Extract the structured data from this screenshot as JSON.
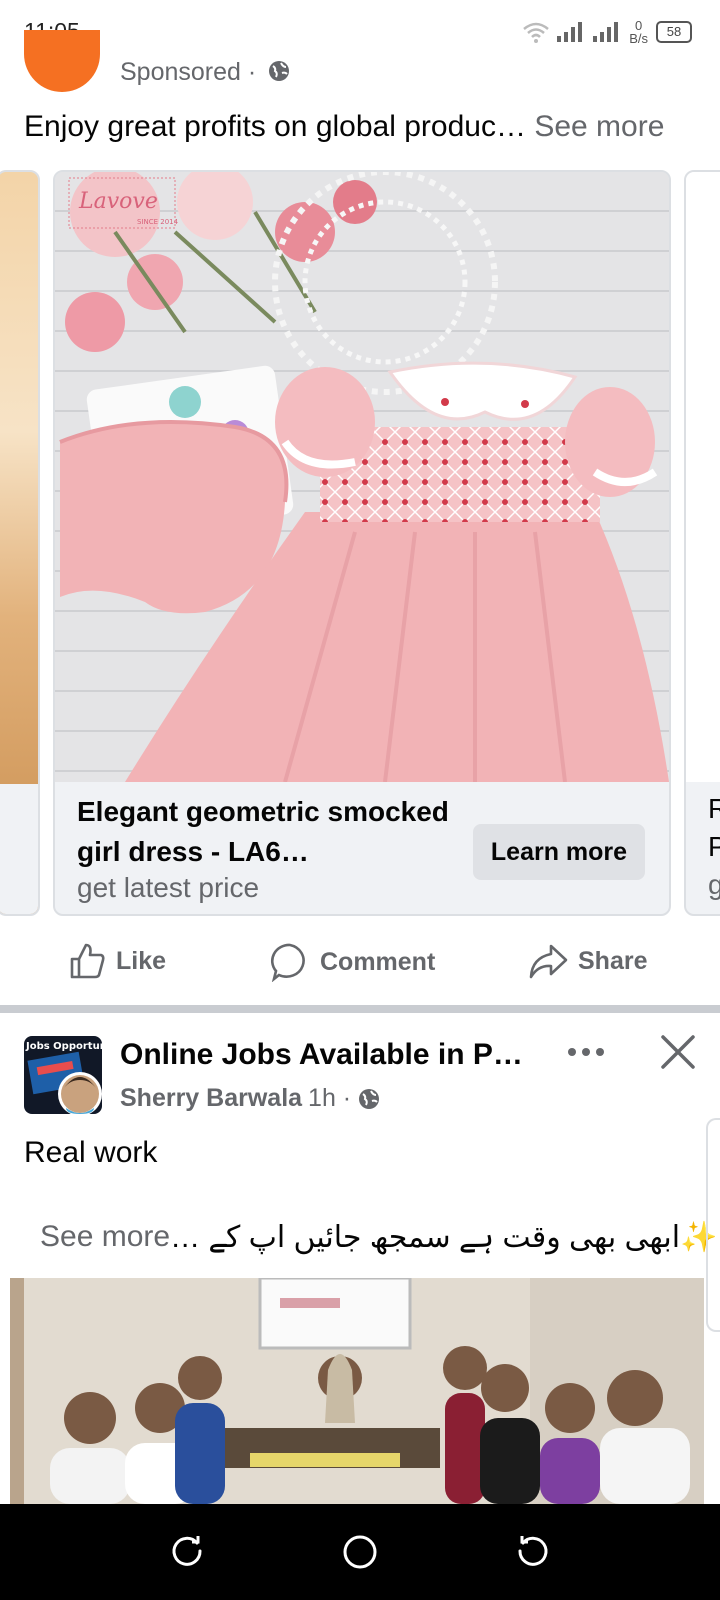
{
  "status_bar": {
    "time": "11:05",
    "net_speed": "0",
    "net_unit": "B/s",
    "battery": "58"
  },
  "ad_post": {
    "sponsored": "Sponsored ·",
    "headline": "Enjoy great profits on global produc…",
    "see_more": "See more",
    "card": {
      "brand": "Lavove",
      "brand_since": "SINCE 2014",
      "title": "Elegant geometric smocked girl dress - LA6…",
      "subtitle": "get latest price",
      "cta": "Learn more"
    },
    "right_card_text": [
      "R",
      "P",
      "g"
    ]
  },
  "actions": {
    "like": "Like",
    "comment": "Comment",
    "share": "Share"
  },
  "post": {
    "group_title": "Online Jobs Available in P…",
    "avatar_text": "Jobs Opportunity",
    "author": "Sherry Barwala",
    "time": "1h ·",
    "text": "Real work",
    "urdu_text": "✨ابھی بھی وقت ہے سمجھ جائیں اپ کے …",
    "see_more": "See more"
  },
  "colors": {
    "accent_orange": "#f57022",
    "text_primary": "#050505",
    "text_secondary": "#65676b",
    "card_bg": "#f0f2f5",
    "dress_pink": "#f2b3b6"
  }
}
